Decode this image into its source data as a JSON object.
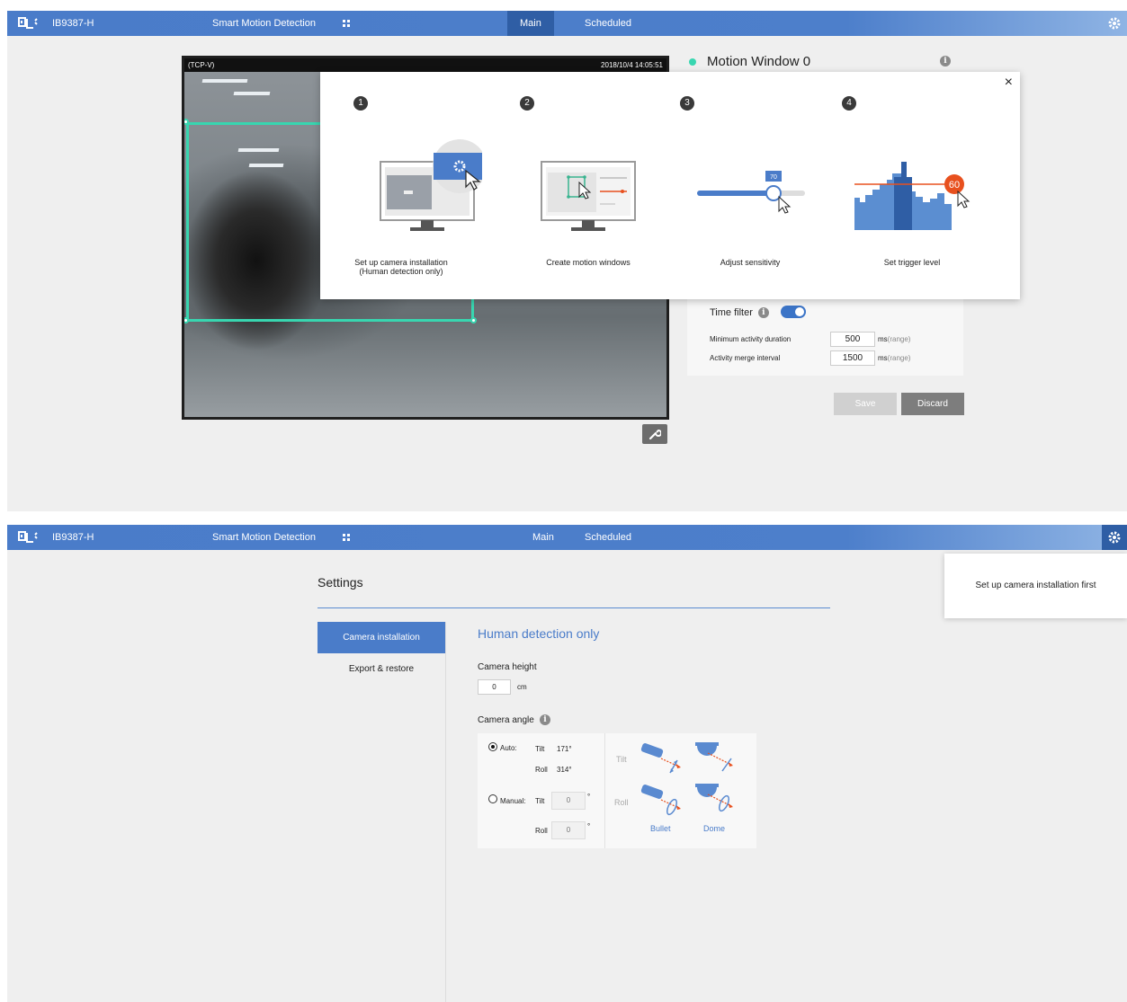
{
  "header": {
    "device_name": "IB9387-H",
    "app_name": "Smart Motion Detection",
    "tabs": [
      {
        "label": "Main"
      },
      {
        "label": "Scheduled"
      }
    ]
  },
  "video": {
    "stream_label": "(TCP-V)",
    "timestamp": "2018/10/4 14:05:51"
  },
  "motion_window": {
    "title": "Motion Window 0",
    "indicator_color": "#38d6b0"
  },
  "time_filter": {
    "label": "Time filter",
    "enabled": true,
    "min_activity_label": "Minimum activity duration",
    "min_activity_value": "500",
    "merge_interval_label": "Activity merge interval",
    "merge_interval_value": "1500",
    "unit_ms": "ms",
    "unit_range": "(range)"
  },
  "actions": {
    "save_label": "Save",
    "discard_label": "Discard"
  },
  "wizard": {
    "close_glyph": "×",
    "steps": [
      {
        "number": "1",
        "caption": "Set up camera installation\n(Human detection only)"
      },
      {
        "number": "2",
        "caption": "Create motion windows"
      },
      {
        "number": "3",
        "caption": "Adjust sensitivity",
        "badge": "70"
      },
      {
        "number": "4",
        "caption": "Set trigger level",
        "badge": "60"
      }
    ]
  },
  "settings": {
    "title": "Settings",
    "nav": [
      {
        "label": "Camera installation",
        "active": true
      },
      {
        "label": "Export & restore",
        "active": false
      }
    ],
    "section_title": "Human detection only",
    "camera_height_label": "Camera height",
    "camera_height_value": "0",
    "camera_height_unit": "cm",
    "camera_angle_label": "Camera angle",
    "auto_label": "Auto:",
    "manual_label": "Manual:",
    "auto_tilt_label": "Tilt",
    "auto_tilt_value": "171°",
    "auto_roll_label": "Roll",
    "auto_roll_value": "314°",
    "manual_tilt_label": "Tilt",
    "manual_tilt_value": "0",
    "manual_roll_label": "Roll",
    "manual_roll_value": "0",
    "degree": "°",
    "diagram_tilt_label": "Tilt",
    "diagram_roll_label": "Roll",
    "bullet_label": "Bullet",
    "dome_label": "Dome",
    "tooltip": "Set up camera installation first"
  },
  "colors": {
    "brand_blue": "#4a7cc9",
    "accent_orange": "#e8501e",
    "motion_teal": "#38d6b0"
  }
}
